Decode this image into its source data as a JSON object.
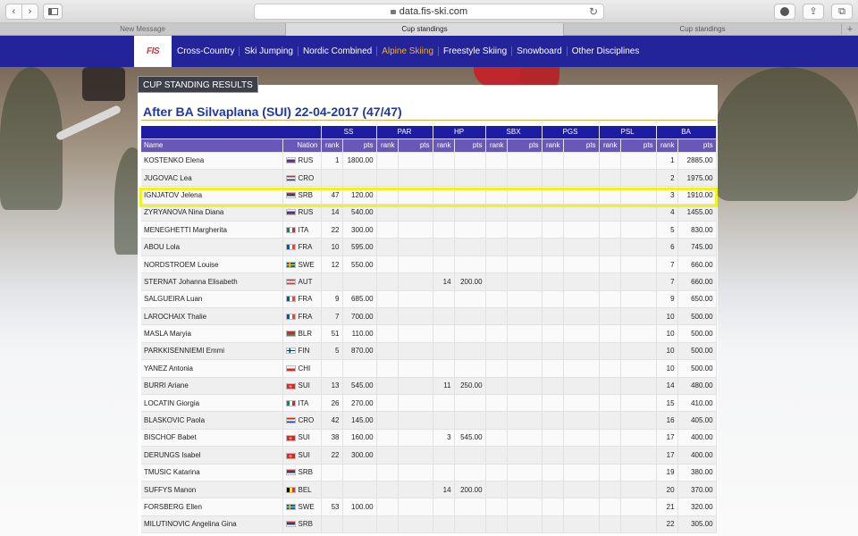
{
  "browser": {
    "url": "data.fis-ski.com",
    "tabs": [
      "New Message",
      "Cup standings",
      "Cup standings"
    ]
  },
  "nav": {
    "logo": "FIS",
    "links": [
      "Cross-Country",
      "Ski Jumping",
      "Nordic Combined",
      "Alpine Skiing",
      "Freestyle Skiing",
      "Snowboard",
      "Other Disciplines"
    ],
    "active_index": 3,
    "accent": "#f5b21a",
    "bar_color": "#23239a"
  },
  "section_label": "CUP STANDING RESULTS",
  "page_title": "After BA Silvaplana (SUI) 22-04-2017 (47/47)",
  "table": {
    "group_headers": [
      "SS",
      "PAR",
      "HP",
      "SBX",
      "PGS",
      "PSL",
      "BA"
    ],
    "sub_headers": {
      "name": "Name",
      "nation": "Nation",
      "rank": "rank",
      "pts": "pts"
    },
    "highlighted_row": 2,
    "rows": [
      {
        "name": "KOSTENKO Elena",
        "nation": "RUS",
        "flag": "rus",
        "ss_rank": "1",
        "ss_pts": "1800.00",
        "hp_rank": "",
        "hp_pts": "",
        "ba_rank": "1",
        "ba_pts": "2885.00"
      },
      {
        "name": "JUGOVAC Lea",
        "nation": "CRO",
        "flag": "cro",
        "ss_rank": "",
        "ss_pts": "",
        "hp_rank": "",
        "hp_pts": "",
        "ba_rank": "2",
        "ba_pts": "1975.00"
      },
      {
        "name": "IGNJATOV Jelena",
        "nation": "SRB",
        "flag": "srb",
        "ss_rank": "47",
        "ss_pts": "120.00",
        "hp_rank": "",
        "hp_pts": "",
        "ba_rank": "3",
        "ba_pts": "1910.00"
      },
      {
        "name": "ZYRYANOVA Nina Diana",
        "nation": "RUS",
        "flag": "rus",
        "ss_rank": "14",
        "ss_pts": "540.00",
        "hp_rank": "",
        "hp_pts": "",
        "ba_rank": "4",
        "ba_pts": "1455.00"
      },
      {
        "name": "MENEGHETTI Margherita",
        "nation": "ITA",
        "flag": "ita",
        "ss_rank": "22",
        "ss_pts": "300.00",
        "hp_rank": "",
        "hp_pts": "",
        "ba_rank": "5",
        "ba_pts": "830.00"
      },
      {
        "name": "ABOU Lola",
        "nation": "FRA",
        "flag": "fra",
        "ss_rank": "10",
        "ss_pts": "595.00",
        "hp_rank": "",
        "hp_pts": "",
        "ba_rank": "6",
        "ba_pts": "745.00"
      },
      {
        "name": "NORDSTROEM Louise",
        "nation": "SWE",
        "flag": "swe",
        "ss_rank": "12",
        "ss_pts": "550.00",
        "hp_rank": "",
        "hp_pts": "",
        "ba_rank": "7",
        "ba_pts": "660.00"
      },
      {
        "name": "STERNAT Johanna Elisabeth",
        "nation": "AUT",
        "flag": "aut",
        "ss_rank": "",
        "ss_pts": "",
        "hp_rank": "14",
        "hp_pts": "200.00",
        "ba_rank": "7",
        "ba_pts": "660.00"
      },
      {
        "name": "SALGUEIRA Luan",
        "nation": "FRA",
        "flag": "fra",
        "ss_rank": "9",
        "ss_pts": "685.00",
        "hp_rank": "",
        "hp_pts": "",
        "ba_rank": "9",
        "ba_pts": "650.00"
      },
      {
        "name": "LAROCHAIX Thalie",
        "nation": "FRA",
        "flag": "fra",
        "ss_rank": "7",
        "ss_pts": "700.00",
        "hp_rank": "",
        "hp_pts": "",
        "ba_rank": "10",
        "ba_pts": "500.00"
      },
      {
        "name": "MASLA Maryia",
        "nation": "BLR",
        "flag": "blr",
        "ss_rank": "51",
        "ss_pts": "110.00",
        "hp_rank": "",
        "hp_pts": "",
        "ba_rank": "10",
        "ba_pts": "500.00"
      },
      {
        "name": "PARKKISENNIEMI Emmi",
        "nation": "FIN",
        "flag": "fin",
        "ss_rank": "5",
        "ss_pts": "870.00",
        "hp_rank": "",
        "hp_pts": "",
        "ba_rank": "10",
        "ba_pts": "500.00"
      },
      {
        "name": "YANEZ Antonia",
        "nation": "CHI",
        "flag": "chi",
        "ss_rank": "",
        "ss_pts": "",
        "hp_rank": "",
        "hp_pts": "",
        "ba_rank": "10",
        "ba_pts": "500.00"
      },
      {
        "name": "BURRI Ariane",
        "nation": "SUI",
        "flag": "sui",
        "ss_rank": "13",
        "ss_pts": "545.00",
        "hp_rank": "11",
        "hp_pts": "250.00",
        "ba_rank": "14",
        "ba_pts": "480.00"
      },
      {
        "name": "LOCATIN Giorgia",
        "nation": "ITA",
        "flag": "ita",
        "ss_rank": "26",
        "ss_pts": "270.00",
        "hp_rank": "",
        "hp_pts": "",
        "ba_rank": "15",
        "ba_pts": "410.00"
      },
      {
        "name": "BLASKOVIC Paola",
        "nation": "CRO",
        "flag": "cro",
        "ss_rank": "42",
        "ss_pts": "145.00",
        "hp_rank": "",
        "hp_pts": "",
        "ba_rank": "16",
        "ba_pts": "405.00"
      },
      {
        "name": "BISCHOF Babet",
        "nation": "SUI",
        "flag": "sui",
        "ss_rank": "38",
        "ss_pts": "160.00",
        "hp_rank": "3",
        "hp_pts": "545.00",
        "ba_rank": "17",
        "ba_pts": "400.00"
      },
      {
        "name": "DERUNGS Isabel",
        "nation": "SUI",
        "flag": "sui",
        "ss_rank": "22",
        "ss_pts": "300.00",
        "hp_rank": "",
        "hp_pts": "",
        "ba_rank": "17",
        "ba_pts": "400.00"
      },
      {
        "name": "TMUSIC Katarina",
        "nation": "SRB",
        "flag": "srb",
        "ss_rank": "",
        "ss_pts": "",
        "hp_rank": "",
        "hp_pts": "",
        "ba_rank": "19",
        "ba_pts": "380.00"
      },
      {
        "name": "SUFFYS Manon",
        "nation": "BEL",
        "flag": "bel",
        "ss_rank": "",
        "ss_pts": "",
        "hp_rank": "14",
        "hp_pts": "200.00",
        "ba_rank": "20",
        "ba_pts": "370.00"
      },
      {
        "name": "FORSBERG Ellen",
        "nation": "SWE",
        "flag": "swe",
        "ss_rank": "53",
        "ss_pts": "100.00",
        "hp_rank": "",
        "hp_pts": "",
        "ba_rank": "21",
        "ba_pts": "320.00"
      },
      {
        "name": "MILUTINOVIC Angelina Gina",
        "nation": "SRB",
        "flag": "srb",
        "ss_rank": "",
        "ss_pts": "",
        "hp_rank": "",
        "hp_pts": "",
        "ba_rank": "22",
        "ba_pts": "305.00"
      }
    ]
  }
}
